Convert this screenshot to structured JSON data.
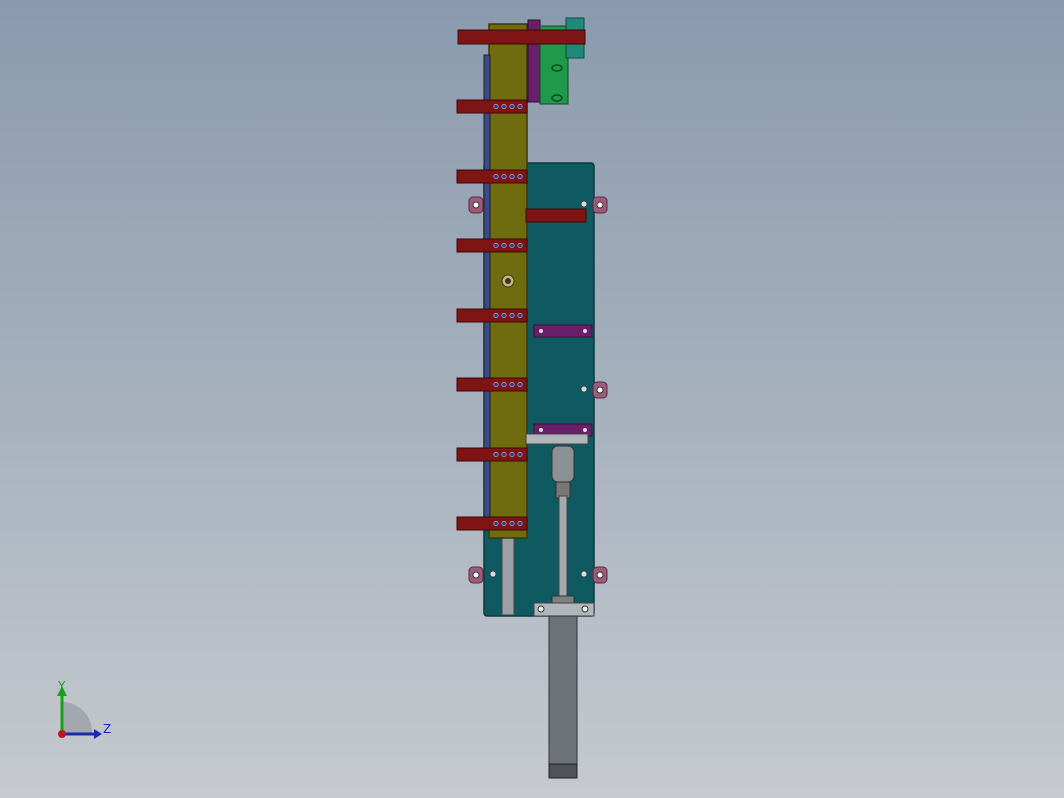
{
  "viewport": {
    "background_top": "#8a9aae",
    "background_bottom": "#c6cacf"
  },
  "model": {
    "colors": {
      "frame_plate": "#0f5a60",
      "frame_plate_edge": "#0a3a3e",
      "slide_rail": "#6f6c0f",
      "slide_rail_edge": "#3a3a08",
      "clamp_arm": "#7e1414",
      "clamp_arm_edge": "#3f0808",
      "bracket": "#6a1f6a",
      "top_block_green": "#1f9a4a",
      "top_block_teal": "#1f8a7a",
      "cylinder_body": "#6e7378",
      "rod": "#a3a9ae",
      "mount_ear": "#9c5b78"
    },
    "clamp_arm_count": 8
  },
  "triad": {
    "y_label": "Y",
    "z_label": "Z",
    "y_color": "#1aa01a",
    "z_color": "#1a2ab0",
    "x_color": "#c01818"
  }
}
